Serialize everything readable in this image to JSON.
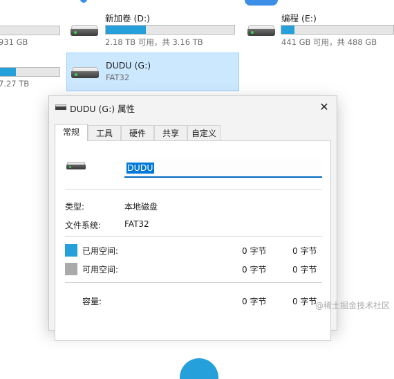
{
  "drives": [
    {
      "name": "",
      "space": "931 GB",
      "fill_fraction": 0.0
    },
    {
      "name": "新加卷 (D:)",
      "space": "2.18 TB 可用，共 3.16 TB",
      "fill_fraction": 0.31
    },
    {
      "name": "编程 (E:)",
      "space": "441 GB 可用，共 488 GB",
      "fill_fraction": 0.1
    },
    {
      "name": "",
      "space": "7.27 TB",
      "fill_fraction": 0.55
    },
    {
      "name": "DUDU (G:)",
      "space": "FAT32",
      "fill_fraction": null
    }
  ],
  "dialog": {
    "title": "DUDU (G:) 属性",
    "close_glyph": "✕",
    "tabs": [
      "常规",
      "工具",
      "硬件",
      "共享",
      "自定义"
    ],
    "active_tab": 0,
    "volume_name": "DUDU",
    "type_label": "类型:",
    "type_value": "本地磁盘",
    "fs_label": "文件系统:",
    "fs_value": "FAT32",
    "used_label": "已用空间:",
    "used_value": "0 字节",
    "used_value2": "0 字节",
    "free_label": "可用空间:",
    "free_value": "0 字节",
    "free_value2": "0 字节",
    "capacity_label": "容量:",
    "capacity_value": "0 字节",
    "capacity_value2": "0 字节"
  },
  "colors": {
    "used": "#26a0da",
    "free": "#aaaaaa",
    "accent": "#0067c0",
    "selection": "#cce8ff"
  },
  "watermark": "@稀土掘金技术社区"
}
